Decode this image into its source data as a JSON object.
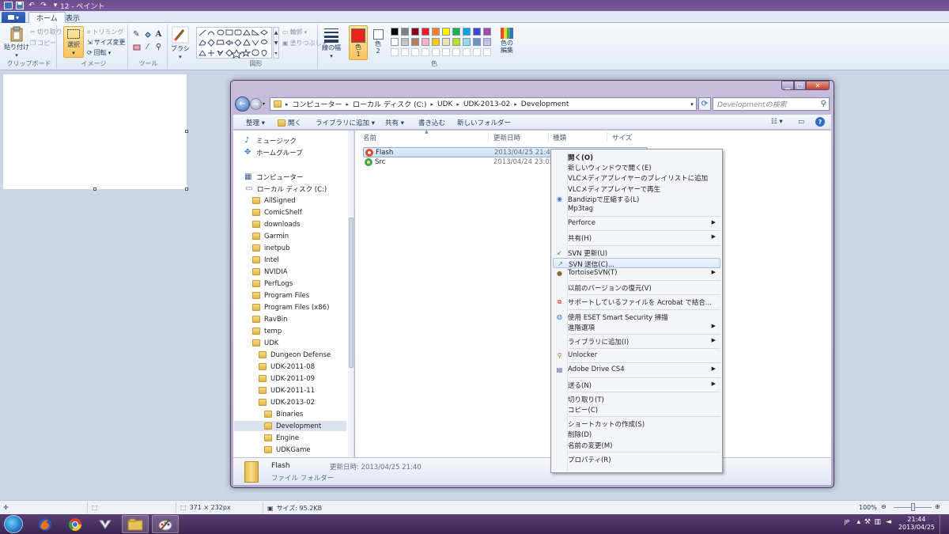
{
  "app": {
    "title": "12 - ペイント"
  },
  "ribbon": {
    "file_menu": "▾",
    "tabs": [
      "ホーム",
      "表示"
    ],
    "clipboard": {
      "paste": "貼り付け",
      "cut": "切り取り",
      "copy": "コピー",
      "label": "クリップボード"
    },
    "image": {
      "select": "選択",
      "crop": "トリミング",
      "resize": "サイズ変更",
      "rotate": "回転",
      "label": "イメージ"
    },
    "tools": {
      "label": "ツール"
    },
    "brushes": {
      "label": "ブラシ"
    },
    "shapes": {
      "outline": "輪郭",
      "fill": "塗りつぶし",
      "label": "図形"
    },
    "size": {
      "label": "線の幅"
    },
    "colors": {
      "color1": "色 1",
      "color2": "色 2",
      "edit": "色の編集",
      "label": "色",
      "primary_hex": "#e8241a",
      "secondary_hex": "#ffffff",
      "palette_row1": [
        "#000000",
        "#7f7f7f",
        "#880015",
        "#ed1c24",
        "#ff7f27",
        "#fff200",
        "#22b14c",
        "#00a2e8",
        "#3f48cc",
        "#a349a4"
      ],
      "palette_row2": [
        "#ffffff",
        "#c3c3c3",
        "#b97a57",
        "#ffaec9",
        "#ffc90e",
        "#efe4b0",
        "#b5e61d",
        "#99d9ea",
        "#7092be",
        "#c8bfe7"
      ]
    }
  },
  "status": {
    "size": "371 × 232px",
    "file_size": "サイズ: 95.2KB",
    "zoom": "100%"
  },
  "explorer": {
    "breadcrumb": [
      "コンピューター",
      "ローカル ディスク (C:)",
      "UDK",
      "UDK-2013-02",
      "Development"
    ],
    "search_placeholder": "Developmentの検索",
    "toolbar": [
      "整理 ▾",
      "開く",
      "ライブラリに追加 ▾",
      "共有 ▾",
      "書き込む",
      "新しいフォルダー"
    ],
    "nav": [
      {
        "label": "ミュージック",
        "icon": "music-icon"
      },
      {
        "label": "ホームグループ",
        "icon": "homegroup-icon"
      },
      {
        "label": "コンピューター",
        "icon": "computer-icon"
      },
      {
        "label": "ローカル ディスク (C:)",
        "icon": "drive-icon"
      },
      {
        "label": "AllSigned"
      },
      {
        "label": "ComicShelf"
      },
      {
        "label": "downloads"
      },
      {
        "label": "Garmin"
      },
      {
        "label": "inetpub"
      },
      {
        "label": "Intel"
      },
      {
        "label": "NVIDIA"
      },
      {
        "label": "PerfLogs"
      },
      {
        "label": "Program Files"
      },
      {
        "label": "Program Files (x86)"
      },
      {
        "label": "RavBin"
      },
      {
        "label": "temp"
      },
      {
        "label": "UDK"
      },
      {
        "label": "Dungeon Defense"
      },
      {
        "label": "UDK-2011-08"
      },
      {
        "label": "UDK-2011-09"
      },
      {
        "label": "UDK-2011-11"
      },
      {
        "label": "UDK-2013-02"
      },
      {
        "label": "Binaries"
      },
      {
        "label": "Development"
      },
      {
        "label": "Engine"
      },
      {
        "label": "UDKGame"
      }
    ],
    "columns": [
      "名前",
      "更新日時",
      "種類",
      "サイズ"
    ],
    "files": [
      {
        "name": "Flash",
        "date": "2013/04/25 21:40"
      },
      {
        "name": "Src",
        "date": "2013/04/24 23:05"
      }
    ],
    "details": {
      "name": "Flash",
      "date": "更新日時: 2013/04/25 21:40",
      "type": "ファイル フォルダー"
    }
  },
  "context_menu": {
    "items": [
      {
        "label": "開く(O)",
        "bold": true
      },
      {
        "label": "新しいウィンドウで開く(E)"
      },
      {
        "label": "VLCメディアプレイヤーのプレイリストに追加"
      },
      {
        "label": "VLCメディアプレイヤーで再生"
      },
      {
        "label": "Bandizipで圧縮する(L)",
        "icon": "bandizip-icon"
      },
      {
        "label": "Mp3tag"
      },
      {
        "label": "Perforce",
        "submenu": true
      },
      {
        "label": "共有(H)",
        "submenu": true
      },
      {
        "label": "SVN 更新(U)",
        "icon": "svn-update-icon"
      },
      {
        "label": "SVN 送信(C)...",
        "icon": "svn-commit-icon",
        "hover": true
      },
      {
        "label": "TortoiseSVN(T)",
        "icon": "tortoise-icon",
        "submenu": true
      },
      {
        "label": "以前のバージョンの復元(V)"
      },
      {
        "label": "サポートしているファイルを Acrobat で結合...",
        "icon": "acrobat-icon"
      },
      {
        "label": "使用 ESET Smart Security 掃描",
        "icon": "eset-icon"
      },
      {
        "label": "進階選項",
        "submenu": true
      },
      {
        "label": "ライブラリに追加(I)",
        "submenu": true
      },
      {
        "label": "Unlocker",
        "icon": "unlocker-icon"
      },
      {
        "label": "Adobe Drive CS4",
        "icon": "adobe-drive-icon",
        "submenu": true
      },
      {
        "label": "送る(N)",
        "submenu": true
      },
      {
        "label": "切り取り(T)"
      },
      {
        "label": "コピー(C)"
      },
      {
        "label": "ショートカットの作成(S)"
      },
      {
        "label": "削除(D)"
      },
      {
        "label": "名前の変更(M)"
      },
      {
        "label": "プロパティ(R)"
      }
    ]
  },
  "taskbar": {
    "lang": "JP",
    "time": "21:44",
    "date": "2013/04/25"
  }
}
